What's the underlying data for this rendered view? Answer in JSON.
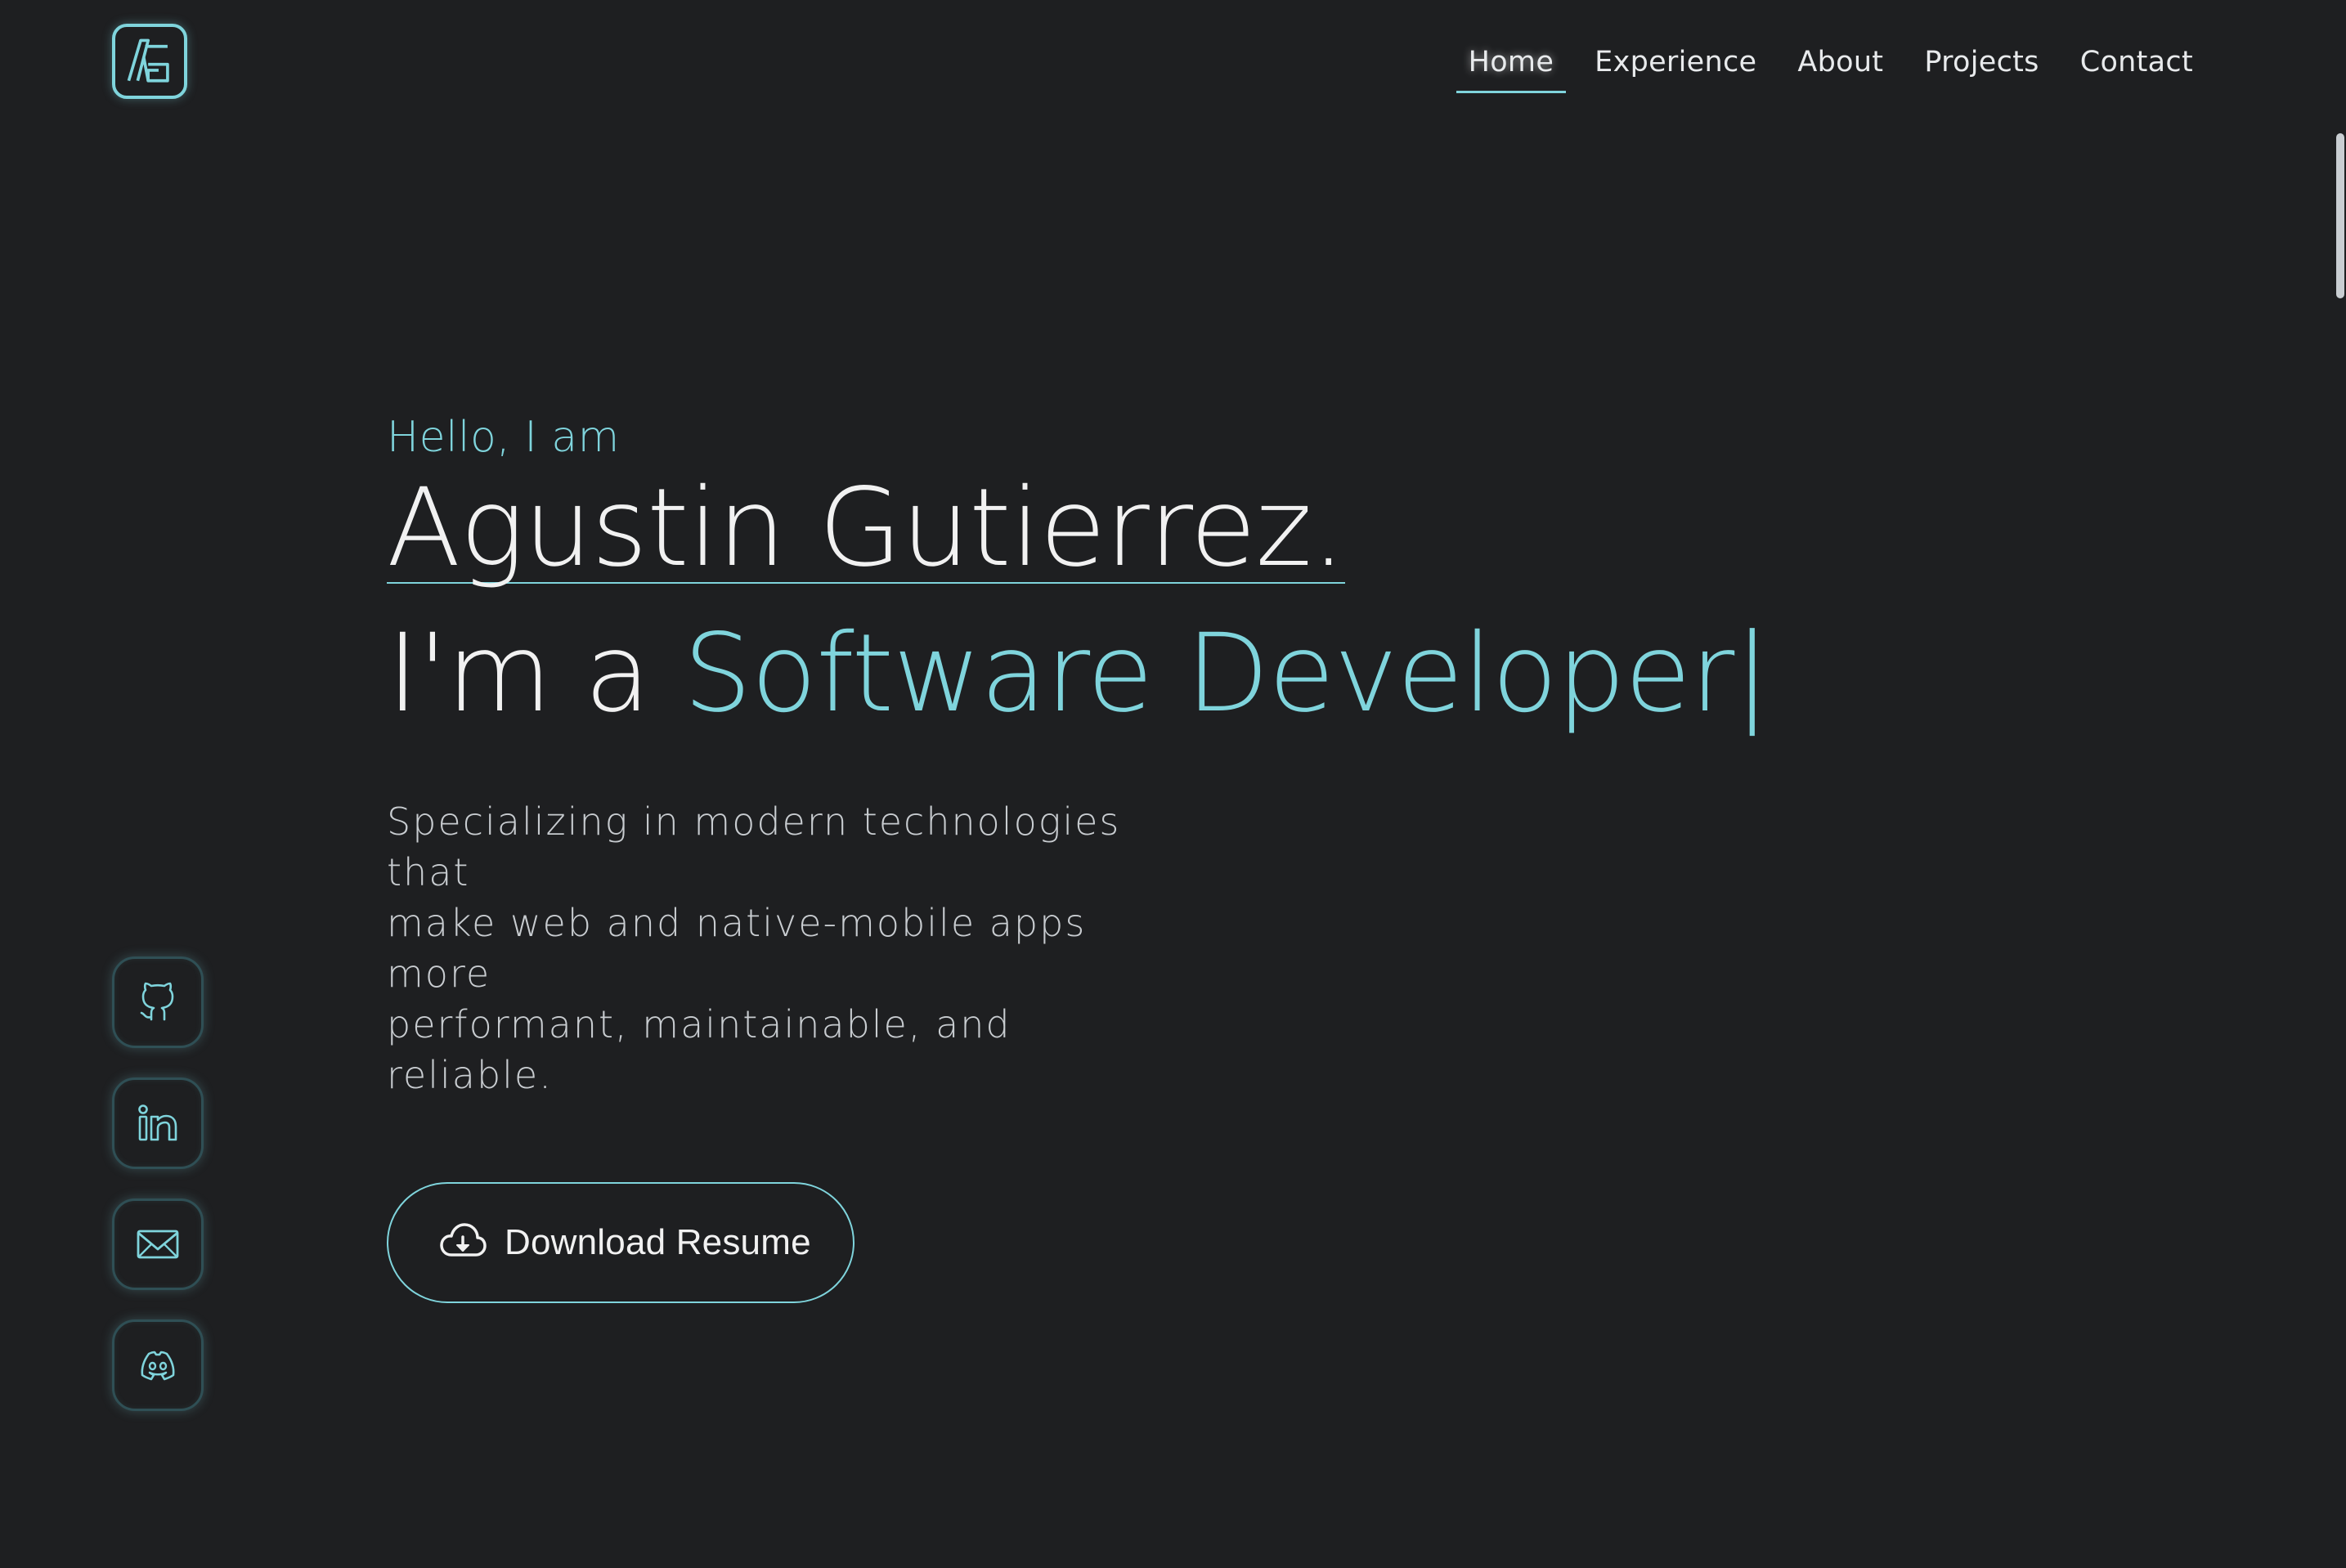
{
  "header": {
    "logo": {
      "icon": "ag-monogram-logo"
    },
    "nav": [
      {
        "label": "Home",
        "active": true
      },
      {
        "label": "Experience",
        "active": false
      },
      {
        "label": "About",
        "active": false
      },
      {
        "label": "Projects",
        "active": false
      },
      {
        "label": "Contact",
        "active": false
      }
    ]
  },
  "hero": {
    "greeting": "Hello, I am",
    "name": "Agustin Gutierrez.",
    "role_prefix": "I'm a ",
    "role": "Software Developer",
    "cursor": "|",
    "tagline_lines": [
      "Specializing in modern technologies that",
      "make web and native-mobile apps more",
      "performant, maintainable, and reliable."
    ],
    "download_button": {
      "label": "Download Resume",
      "icon": "cloud-download-icon"
    }
  },
  "social": [
    {
      "icon": "github-icon"
    },
    {
      "icon": "linkedin-icon"
    },
    {
      "icon": "mail-icon"
    },
    {
      "icon": "discord-icon"
    }
  ],
  "colors": {
    "background": "#1e1f21",
    "accent": "#7fd4dc",
    "text": "#f1f1f1",
    "muted": "#c8ccd0"
  }
}
